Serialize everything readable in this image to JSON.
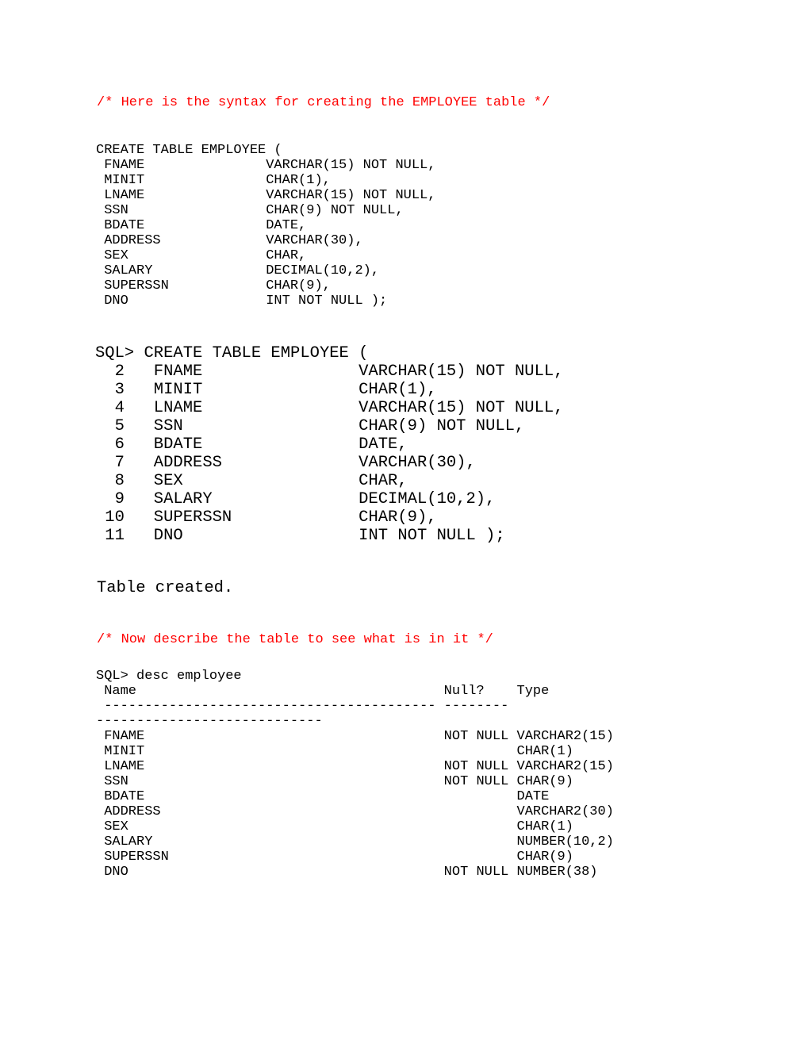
{
  "document": {
    "page_background": "#ffffff",
    "text_color": "#000000",
    "comment_color": "#ff0000"
  },
  "comment_create": "/* Here is the syntax for creating the EMPLOYEE table */",
  "comment_desc": "/* Now describe the table to see what is in it */",
  "create_block": {
    "header": "CREATE TABLE EMPLOYEE (",
    "lines": [
      " FNAME               VARCHAR(15) NOT NULL,",
      " MINIT               CHAR(1),",
      " LNAME               VARCHAR(15) NOT NULL,",
      " SSN                 CHAR(9) NOT NULL,",
      " BDATE               DATE,",
      " ADDRESS             VARCHAR(30),",
      " SEX                 CHAR,",
      " SALARY              DECIMAL(10,2),",
      " SUPERSSN            CHAR(9),",
      " DNO                 INT NOT NULL );"
    ]
  },
  "session_block": {
    "prompt_line": "SQL> CREATE TABLE EMPLOYEE (",
    "lines": [
      "  2   FNAME                VARCHAR(15) NOT NULL,",
      "  3   MINIT                CHAR(1),",
      "  4   LNAME                VARCHAR(15) NOT NULL,",
      "  5   SSN                  CHAR(9) NOT NULL,",
      "  6   BDATE                DATE,",
      "  7   ADDRESS              VARCHAR(30),",
      "  8   SEX                  CHAR,",
      "  9   SALARY               DECIMAL(10,2),",
      " 10   SUPERSSN             CHAR(9),",
      " 11   DNO                  INT NOT NULL );"
    ]
  },
  "table_created": "Table created.",
  "desc_block": {
    "prompt_line": "SQL> desc employee",
    "header": " Name                                      Null?    Type",
    "separator_line_1": " ----------------------------------------- --------",
    "separator_line_2": "----------------------------",
    "rows": [
      " FNAME                                     NOT NULL VARCHAR2(15)",
      " MINIT                                              CHAR(1)",
      " LNAME                                     NOT NULL VARCHAR2(15)",
      " SSN                                       NOT NULL CHAR(9)",
      " BDATE                                              DATE",
      " ADDRESS                                            VARCHAR2(30)",
      " SEX                                                CHAR(1)",
      " SALARY                                             NUMBER(10,2)",
      " SUPERSSN                                           CHAR(9)",
      " DNO                                       NOT NULL NUMBER(38)"
    ]
  }
}
